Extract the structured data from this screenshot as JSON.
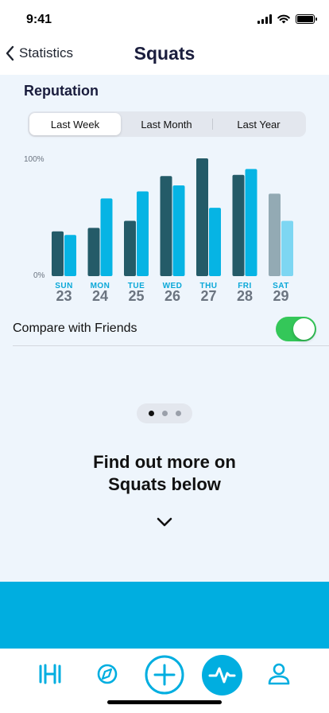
{
  "status_bar": {
    "time": "9:41"
  },
  "nav": {
    "back_label": "Statistics",
    "title": "Squats"
  },
  "section": {
    "title": "Reputation"
  },
  "segments": [
    {
      "label": "Last Week",
      "active": true
    },
    {
      "label": "Last Month",
      "active": false
    },
    {
      "label": "Last Year",
      "active": false
    }
  ],
  "chart_data": {
    "type": "bar",
    "ytick_labels": [
      "100%",
      "0%"
    ],
    "ylim": [
      0,
      100
    ],
    "categories": [
      "SUN",
      "MON",
      "TUE",
      "WED",
      "THU",
      "FRI",
      "SAT"
    ],
    "dates": [
      "23",
      "24",
      "25",
      "26",
      "27",
      "28",
      "29"
    ],
    "series": [
      {
        "values": [
          38,
          41,
          47,
          85,
          100,
          86,
          70
        ]
      },
      {
        "values": [
          35,
          66,
          72,
          77,
          58,
          91,
          47
        ]
      }
    ],
    "highlighted_days": [
      "SUN",
      "MON",
      "TUE",
      "WED",
      "THU",
      "FRI"
    ],
    "dimmed_days": [
      "SAT"
    ],
    "colors": {
      "series_dark": "#245b68",
      "series_light": "#06b4e4",
      "dim_dark": "#93aab4",
      "dim_light": "#7dd6f2",
      "day_label": "#0aa8d8",
      "date_label": "#6b7480",
      "axis_label": "#6b7480"
    }
  },
  "compare": {
    "label": "Compare with Friends",
    "enabled": true
  },
  "pager": {
    "count": 3,
    "active_index": 0
  },
  "more": {
    "line1": "Find out more on",
    "line2": "Squats below"
  },
  "tab_bar": {
    "items": [
      {
        "icon": "dumbbell-icon",
        "active": false
      },
      {
        "icon": "compass-icon",
        "active": false
      },
      {
        "icon": "plus-circle-icon",
        "active": false
      },
      {
        "icon": "activity-icon",
        "active": true
      },
      {
        "icon": "user-icon",
        "active": false
      }
    ],
    "accent": "#00aee0"
  }
}
